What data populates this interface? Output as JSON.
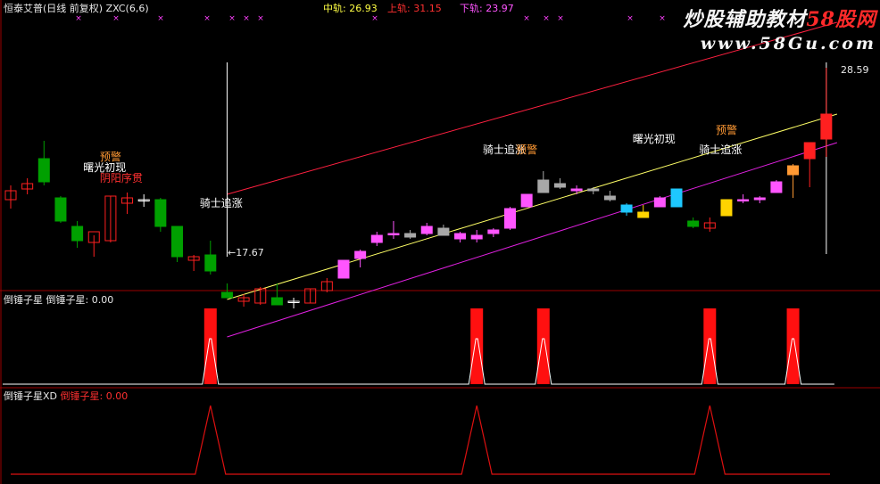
{
  "header": {
    "stock": "恒泰艾普(日线 前复权)",
    "indicator": "ZXC(6,6)",
    "mid_label": "中轨: 26.93",
    "up_label": "上轨: 31.15",
    "low_label": "下轨: 23.97"
  },
  "watermark": {
    "brand_white": "炒股辅助教材",
    "brand_red": "58股网",
    "url": "www.58Gu.com"
  },
  "price_labels": {
    "high": "28.59",
    "low": "←17.67"
  },
  "panel2": {
    "title": "倒锤子星",
    "value_label": "倒锤子星: 0.00"
  },
  "panel3": {
    "title": "倒锤子星XD",
    "value_label": "倒锤子星: 0.00"
  },
  "colors": {
    "up": "#ff2020",
    "down": "#00a000",
    "pink": "#ff55ff",
    "gray": "#a8a8a8",
    "cyan": "#1ec8ff",
    "yellow": "#ffd400",
    "channel_up": "#ff2040",
    "channel_mid": "#ffff66",
    "channel_low": "#e020e0",
    "orange": "#ff9933"
  },
  "chart_data": {
    "type": "candlestick",
    "price_range": [
      16.5,
      31.5
    ],
    "candles": [
      {
        "o": 21.2,
        "h": 22.0,
        "l": 20.7,
        "c": 21.7,
        "s": "hollow"
      },
      {
        "o": 21.8,
        "h": 22.4,
        "l": 21.5,
        "c": 22.1,
        "s": "hollow"
      },
      {
        "o": 23.5,
        "h": 24.5,
        "l": 22.0,
        "c": 22.2,
        "s": "down"
      },
      {
        "o": 21.3,
        "h": 21.4,
        "l": 19.9,
        "c": 20.0,
        "s": "down"
      },
      {
        "o": 19.7,
        "h": 20.0,
        "l": 18.5,
        "c": 18.9,
        "s": "down"
      },
      {
        "o": 18.8,
        "h": 19.2,
        "l": 18.0,
        "c": 19.4,
        "s": "hollow"
      },
      {
        "o": 18.9,
        "h": 21.4,
        "l": 18.8,
        "c": 21.4,
        "s": "hollow"
      },
      {
        "o": 21.0,
        "h": 21.6,
        "l": 20.4,
        "c": 21.3,
        "s": "hollow"
      },
      {
        "o": 21.2,
        "h": 21.5,
        "l": 20.8,
        "c": 21.2,
        "s": "doji"
      },
      {
        "o": 21.2,
        "h": 21.3,
        "l": 19.4,
        "c": 19.7,
        "s": "down"
      },
      {
        "o": 19.7,
        "h": 19.7,
        "l": 17.7,
        "c": 18.0,
        "s": "down"
      },
      {
        "o": 17.8,
        "h": 18.1,
        "l": 17.2,
        "c": 18.0,
        "s": "hollow"
      },
      {
        "o": 18.1,
        "h": 18.9,
        "l": 17.0,
        "c": 17.2,
        "s": "down"
      },
      {
        "o": 16.0,
        "h": 16.5,
        "l": 15.7,
        "c": 15.7,
        "s": "down"
      },
      {
        "o": 15.5,
        "h": 15.9,
        "l": 15.2,
        "c": 15.7,
        "s": "hollow"
      },
      {
        "o": 15.4,
        "h": 16.3,
        "l": 15.3,
        "c": 16.2,
        "s": "hollow"
      },
      {
        "o": 15.7,
        "h": 16.5,
        "l": 15.4,
        "c": 15.3,
        "s": "down"
      },
      {
        "o": 15.5,
        "h": 15.7,
        "l": 15.1,
        "c": 15.5,
        "s": "doji"
      },
      {
        "o": 15.4,
        "h": 16.2,
        "l": 15.4,
        "c": 16.2,
        "s": "hollow"
      },
      {
        "o": 16.1,
        "h": 16.8,
        "l": 16.0,
        "c": 16.6,
        "s": "hollow"
      },
      {
        "o": 16.8,
        "h": 17.8,
        "l": 16.8,
        "c": 17.8,
        "s": "pink"
      },
      {
        "o": 17.9,
        "h": 18.4,
        "l": 17.4,
        "c": 18.3,
        "s": "pink"
      },
      {
        "o": 18.8,
        "h": 19.4,
        "l": 18.6,
        "c": 19.2,
        "s": "pink"
      },
      {
        "o": 19.3,
        "h": 20.0,
        "l": 19.0,
        "c": 19.3,
        "s": "pink"
      },
      {
        "o": 19.1,
        "h": 19.5,
        "l": 19.0,
        "c": 19.3,
        "s": "gray"
      },
      {
        "o": 19.3,
        "h": 19.9,
        "l": 19.2,
        "c": 19.7,
        "s": "pink"
      },
      {
        "o": 19.6,
        "h": 19.8,
        "l": 19.3,
        "c": 19.2,
        "s": "gray"
      },
      {
        "o": 19.0,
        "h": 19.4,
        "l": 18.8,
        "c": 19.3,
        "s": "pink"
      },
      {
        "o": 19.2,
        "h": 19.5,
        "l": 18.8,
        "c": 19.0,
        "s": "pink"
      },
      {
        "o": 19.5,
        "h": 19.6,
        "l": 19.1,
        "c": 19.3,
        "s": "pink"
      },
      {
        "o": 19.6,
        "h": 20.8,
        "l": 19.5,
        "c": 20.7,
        "s": "pink"
      },
      {
        "o": 20.8,
        "h": 21.5,
        "l": 20.8,
        "c": 21.5,
        "s": "pink"
      },
      {
        "o": 21.6,
        "h": 22.8,
        "l": 21.6,
        "c": 22.3,
        "s": "gray"
      },
      {
        "o": 22.1,
        "h": 22.4,
        "l": 21.8,
        "c": 21.9,
        "s": "gray"
      },
      {
        "o": 21.7,
        "h": 22.0,
        "l": 21.5,
        "c": 21.8,
        "s": "pink"
      },
      {
        "o": 21.7,
        "h": 21.9,
        "l": 21.5,
        "c": 21.8,
        "s": "gray"
      },
      {
        "o": 21.4,
        "h": 21.7,
        "l": 21.1,
        "c": 21.2,
        "s": "gray"
      },
      {
        "o": 20.5,
        "h": 21.0,
        "l": 20.3,
        "c": 20.9,
        "s": "cyan"
      },
      {
        "o": 20.2,
        "h": 20.9,
        "l": 20.2,
        "c": 20.5,
        "s": "yellow"
      },
      {
        "o": 20.8,
        "h": 21.4,
        "l": 20.8,
        "c": 21.3,
        "s": "pink"
      },
      {
        "o": 20.8,
        "h": 21.8,
        "l": 20.8,
        "c": 21.8,
        "s": "cyan"
      },
      {
        "o": 20.0,
        "h": 20.2,
        "l": 19.6,
        "c": 19.7,
        "s": "down"
      },
      {
        "o": 19.6,
        "h": 20.2,
        "l": 19.4,
        "c": 19.9,
        "s": "hollow"
      },
      {
        "o": 20.3,
        "h": 21.2,
        "l": 20.3,
        "c": 21.2,
        "s": "yellow"
      },
      {
        "o": 21.2,
        "h": 21.5,
        "l": 21.0,
        "c": 21.2,
        "s": "pink"
      },
      {
        "o": 21.2,
        "h": 21.4,
        "l": 21.0,
        "c": 21.3,
        "s": "pink"
      },
      {
        "o": 21.6,
        "h": 22.3,
        "l": 21.6,
        "c": 22.2,
        "s": "pink"
      },
      {
        "o": 22.6,
        "h": 23.2,
        "l": 21.3,
        "c": 23.1,
        "s": "orange"
      },
      {
        "o": 23.5,
        "h": 23.9,
        "l": 21.9,
        "c": 24.4,
        "s": "up"
      },
      {
        "o": 24.6,
        "h": 28.6,
        "l": 23.6,
        "c": 26.0,
        "s": "up"
      }
    ],
    "annotations": [
      {
        "text": "预警",
        "i": 6,
        "p": 23.6,
        "c": "orange"
      },
      {
        "text": "曙光初现",
        "i": 5,
        "p": 23.0,
        "c": "white"
      },
      {
        "text": "阴阳序贯",
        "i": 6,
        "p": 22.4,
        "c": "red"
      },
      {
        "text": "骑士追涨",
        "i": 12,
        "p": 21.0,
        "c": "white"
      },
      {
        "text": "骑士追涨",
        "i": 29,
        "p": 24.0,
        "c": "white"
      },
      {
        "text": "预警",
        "i": 31,
        "p": 24.0,
        "c": "orange"
      },
      {
        "text": "曙光初现",
        "i": 38,
        "p": 24.6,
        "c": "white"
      },
      {
        "text": "预警",
        "i": 43,
        "p": 25.1,
        "c": "orange"
      },
      {
        "text": "骑士追涨",
        "i": 42,
        "p": 24.0,
        "c": "white"
      }
    ],
    "signals": [
      12,
      28,
      32,
      42,
      47
    ],
    "signals_xd": [
      12,
      28,
      42
    ]
  }
}
